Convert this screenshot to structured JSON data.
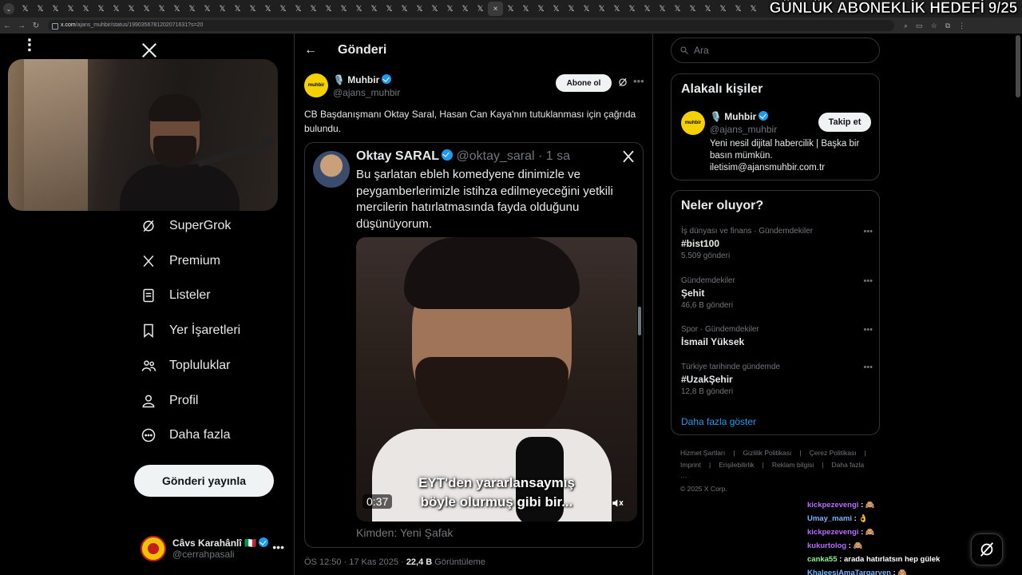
{
  "browser": {
    "tab_count": 49,
    "url_host": "x.com",
    "url_path": "/ajans_muhbir/status/1990356781202071631?s=20"
  },
  "stream_overlay": {
    "goal_text": "GÜNLÜK ABONEKLİK HEDEFİ 9/25"
  },
  "sidebar": {
    "items": [
      {
        "label": "SuperGrok",
        "icon": "grok-icon"
      },
      {
        "label": "Premium",
        "icon": "x-icon"
      },
      {
        "label": "Listeler",
        "icon": "list-icon"
      },
      {
        "label": "Yer İşaretleri",
        "icon": "bookmark-icon"
      },
      {
        "label": "Topluluklar",
        "icon": "people-icon"
      },
      {
        "label": "Profil",
        "icon": "person-icon"
      },
      {
        "label": "Daha fazla",
        "icon": "more-circle-icon"
      }
    ],
    "post_button": "Gönderi yayınla",
    "account": {
      "name": "Câvs Karahânlî 🇮🇹",
      "handle": "@cerrahpasali"
    }
  },
  "main": {
    "title": "Gönderi",
    "tweet": {
      "author_name": "🎙️ Muhbir",
      "author_handle": "@ajans_muhbir",
      "avatar_text": "muhbir",
      "subscribe_label": "Abone ol",
      "text": "CB Başdanışmanı Oktay Saral, Hasan Can Kaya'nın tutuklanması için çağrıda bulundu.",
      "quote": {
        "name": "Oktay SARAL",
        "meta": "@oktay_saral · 1 sa",
        "text": "Bu şarlatan ebleh komedyene dinimizle ve peygamberlerimizle istihza edilmeyeceğini  yetkili mercilerin hatırlatmasında fayda olduğunu düşünüyorum.",
        "video_sub_line1": "EYT'den yararlansaymış",
        "video_sub_line2": "böyle olurmuş gibi bir...",
        "video_time": "0:37",
        "source": "Kimden: Yeni Şafak"
      },
      "time": "ÖS 12:50 · 17 Kas 2025 · ",
      "views_count": "22,4 B",
      "views_label": " Görüntüleme"
    }
  },
  "right": {
    "search_placeholder": "Ara",
    "related": {
      "title": "Alakalı kişiler",
      "name": "🎙️ Muhbir",
      "handle": "@ajans_muhbir",
      "avatar_text": "muhbir",
      "follow_label": "Takip et",
      "bio": "Yeni nesil dijital habercilik | Başka bir basın mümkün. iletisim@ajansmuhbir.com.tr"
    },
    "trends": {
      "title": "Neler oluyor?",
      "items": [
        {
          "context": "İş dünyası ve finans · Gündemdekiler",
          "name": "#bist100",
          "count": "5.509 gönderi"
        },
        {
          "context": "Gündemdekiler",
          "name": "Şehit",
          "count": "46,6 B gönderi"
        },
        {
          "context": "Spor · Gündemdekiler",
          "name": "İsmail Yüksek",
          "count": ""
        },
        {
          "context": "Türkiye tarihinde gündemde",
          "name": "#UzakŞehir",
          "count": "12,8 B gönderi"
        }
      ],
      "show_more": "Daha fazla göster"
    },
    "footer": {
      "line1": [
        "Hizmet Şartları",
        "|",
        "Gizlilik Politikası",
        "|",
        "Çerez Politikası",
        "|"
      ],
      "line2": [
        "Imprint",
        "|",
        "Erişilebilirlik",
        "|",
        "Reklam bilgisi",
        "|",
        "Daha fazla ···"
      ],
      "copyright": "© 2025 X Corp."
    }
  },
  "chat": [
    {
      "user": "kickpezevengi",
      "msg": ": 🙈"
    },
    {
      "user": "Umay_mami",
      "msg": ": 👌"
    },
    {
      "user": "kickpezevengi",
      "msg": ": 🙈"
    },
    {
      "user": "kukurtolog",
      "msg": ": 🙈"
    },
    {
      "user": "canka55",
      "msg": ": arada hatırlatsın hep gülek"
    },
    {
      "user": "KhaleesiAmaTargaryen",
      "msg": ": 🙈"
    }
  ]
}
